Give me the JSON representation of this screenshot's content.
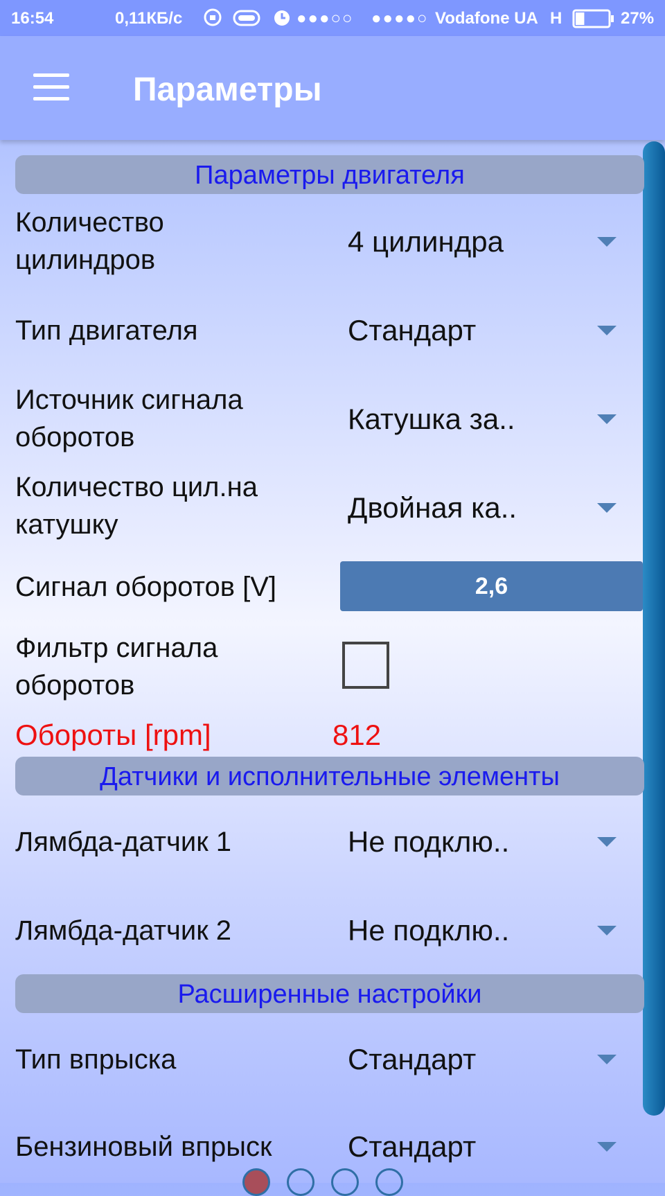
{
  "status_bar": {
    "time": "16:54",
    "speed": "0,11КБ/с",
    "signal_a": "●●●○○",
    "signal_b": "●●●●○",
    "carrier": "Vodafone UA",
    "network": "H",
    "battery_percent": "27%",
    "battery_level": 0.27
  },
  "app_bar": {
    "title": "Параметры"
  },
  "sections": {
    "engine": "Параметры двигателя",
    "sensors": "Датчики и исполнительные элементы",
    "advanced": "Расширенные настройки"
  },
  "rows": {
    "cylinders": {
      "label_1": "Количество",
      "label_2": "цилиндров",
      "value": "4 цилиндра"
    },
    "engine_type": {
      "label": "Тип двигателя",
      "value": "Стандарт"
    },
    "rpm_source": {
      "label_1": "Источник сигнала",
      "label_2": "оборотов",
      "value": "Катушка за.."
    },
    "cyl_per_coil": {
      "label_1": "Количество цил.на",
      "label_2": "катушку",
      "value": "Двойная ка.."
    },
    "rpm_signal": {
      "label": "Сигнал оборотов [V]",
      "value": "2,6"
    },
    "rpm_filter": {
      "label_1": "Фильтр сигнала",
      "label_2": "оборотов",
      "checked": false
    },
    "rpm": {
      "label": "Обороты [rpm]",
      "value": "812"
    },
    "lambda1": {
      "label": "Лямбда-датчик 1",
      "value": "Не подклю.."
    },
    "lambda2": {
      "label": "Лямбда-датчик 2",
      "value": "Не подклю.."
    },
    "injection_type": {
      "label": "Тип впрыска",
      "value": "Стандарт"
    },
    "petrol_injection": {
      "label": "Бензиновый впрыск",
      "value": "Стандарт"
    }
  },
  "pager": {
    "active_index": 0,
    "count": 4,
    "active_color": "#a84e5a",
    "inactive_color": "#2f6fa6"
  }
}
